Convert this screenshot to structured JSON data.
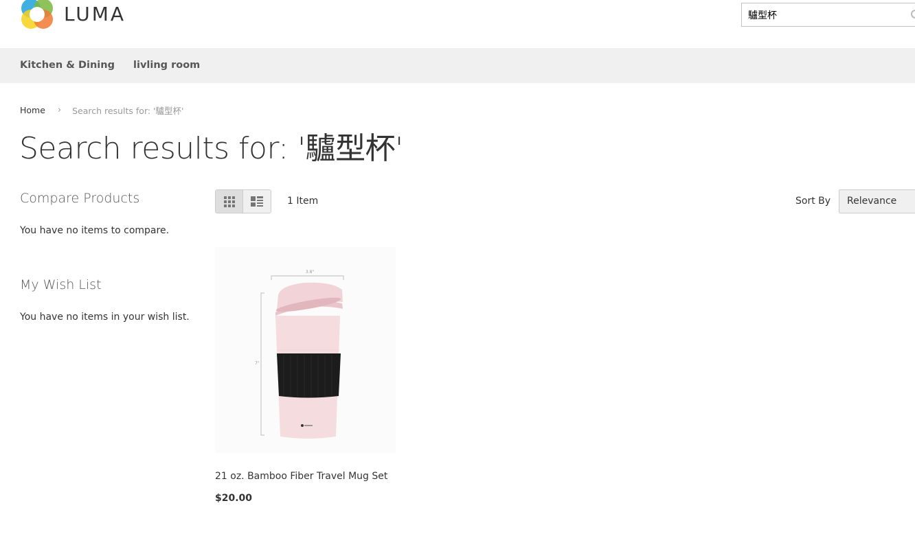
{
  "header": {
    "logo_text": "LUMA",
    "search": {
      "value": "驢型杯",
      "icon": "search-icon"
    }
  },
  "nav": {
    "items": [
      {
        "label": "Kitchen & Dining"
      },
      {
        "label": "livling room"
      }
    ]
  },
  "breadcrumb": {
    "home": "Home",
    "separator_icon": "chevron-right-icon",
    "current": "Search results for: '驢型杯'"
  },
  "page_title": "Search results for: '驢型杯'",
  "sidebar": {
    "compare": {
      "title": "Compare Products",
      "empty_text": "You have no items to compare."
    },
    "wishlist": {
      "title": "My Wish List",
      "empty_text": "You have no items in your wish list."
    }
  },
  "toolbar": {
    "view_modes": [
      {
        "name": "Grid",
        "icon": "grid-icon",
        "active": true
      },
      {
        "name": "List",
        "icon": "list-icon",
        "active": false
      }
    ],
    "amount": "1 Item",
    "sort_label": "Sort By",
    "sort_selected": "Relevance"
  },
  "products": [
    {
      "name": "21 oz. Bamboo Fiber Travel Mug Set",
      "price": "$20.00",
      "image": {
        "alt": "pink travel mug with black sleeve",
        "width_label": "3.8\"",
        "height_label": "7\""
      }
    }
  ],
  "colors": {
    "nav_background": "#f0f0f0",
    "mug_pink": "#f4dcdf",
    "sleeve_black": "#1c1c1c"
  }
}
